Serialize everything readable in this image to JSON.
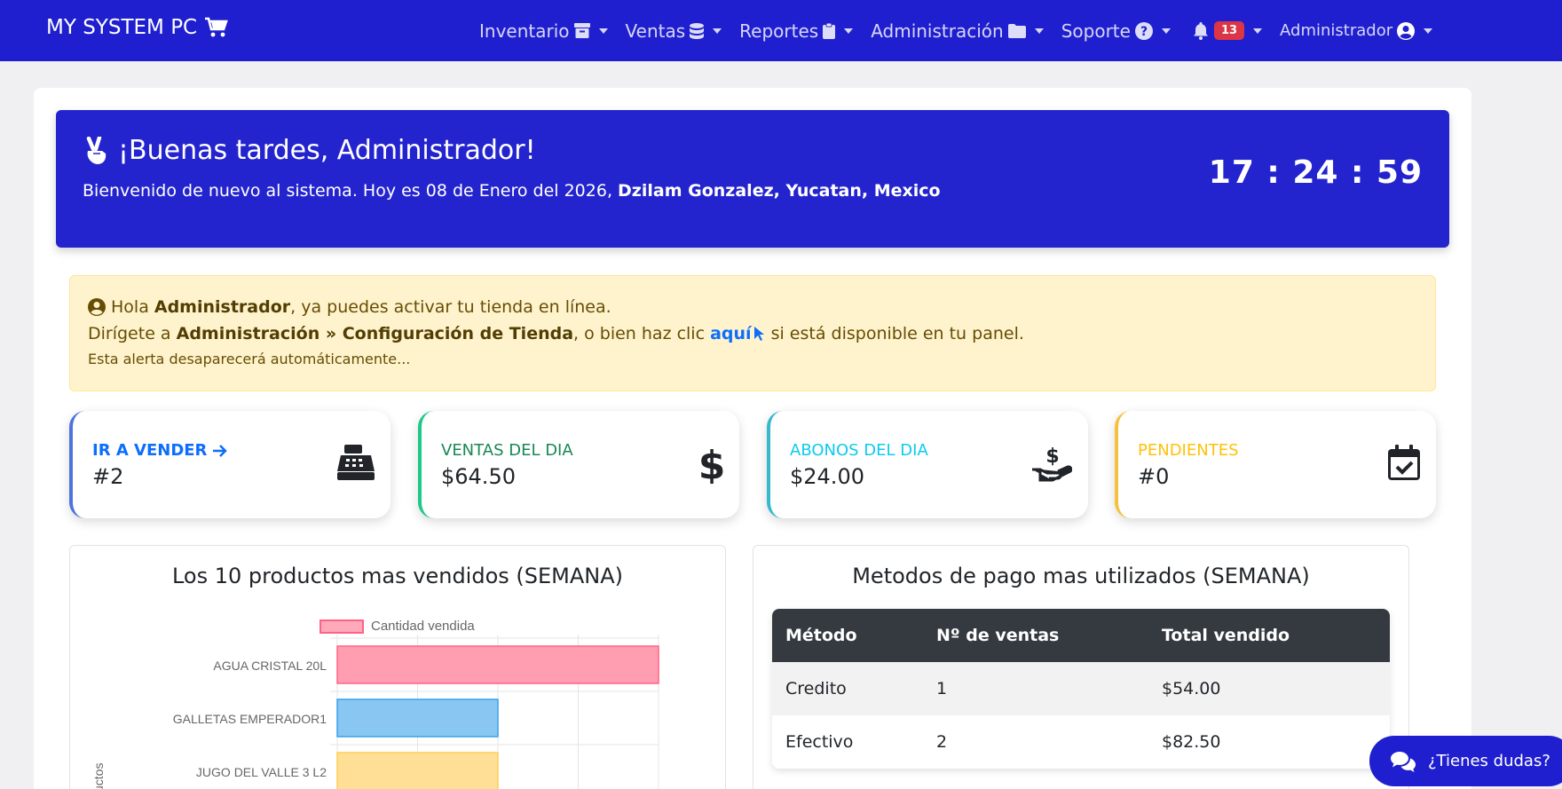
{
  "navbar": {
    "brand": "MY SYSTEM PC",
    "items": [
      {
        "label": "Inventario",
        "icon": "archive-icon"
      },
      {
        "label": "Ventas",
        "icon": "database-icon"
      },
      {
        "label": "Reportes",
        "icon": "clipboard-icon"
      },
      {
        "label": "Administración",
        "icon": "folder-icon"
      },
      {
        "label": "Soporte",
        "icon": "question-circle-icon"
      }
    ],
    "notifications_count": "13",
    "user": "Administrador"
  },
  "welcome": {
    "greeting": "¡Buenas tardes, Administrador!",
    "sub_prefix": "Bienvenido de nuevo al sistema. Hoy es 08 de Enero del 2026, ",
    "location": "Dzilam Gonzalez, Yucatan, Mexico",
    "clock": "17 : 24 : 59"
  },
  "alert": {
    "l1_a": "Hola ",
    "l1_b": "Administrador",
    "l1_c": ", ya puedes activar tu tienda en línea.",
    "l2_a": "Dirígete a ",
    "l2_b": "Administración » Configuración de Tienda",
    "l2_c": ", o bien haz clic ",
    "l2_link": "aquí",
    "l2_d": " si está disponible en tu panel.",
    "l3": "Esta alerta desaparecerá automáticamente..."
  },
  "cards": [
    {
      "label": "IR A VENDER",
      "value": "#2",
      "color": "#4e73df",
      "label_color": "#0d6efd",
      "icon": "cash-register-icon"
    },
    {
      "label": "VENTAS DEL DIA",
      "value": "$64.50",
      "color": "#1cc88a",
      "label_color": "#198754",
      "icon": "dollar-icon"
    },
    {
      "label": "ABONOS DEL DIA",
      "value": "$24.00",
      "color": "#36b9cc",
      "label_color": "#0dcaf0",
      "icon": "hand-holding-dollar-icon"
    },
    {
      "label": "PENDIENTES",
      "value": "#0",
      "color": "#f6c23e",
      "label_color": "#ffc107",
      "icon": "calendar-check-icon"
    }
  ],
  "top_products": {
    "title": "Los 10 productos mas vendidos (SEMANA)",
    "legend": "Cantidad vendida",
    "ylabel_partial": "uctos"
  },
  "chart_data": {
    "type": "bar",
    "orientation": "horizontal",
    "categories": [
      "AGUA CRISTAL 20L",
      "GALLETAS EMPERADOR1",
      "JUGO DEL VALLE 3 L2"
    ],
    "values": [
      4,
      2,
      2
    ],
    "xlim": [
      0,
      4
    ],
    "series": [
      {
        "name": "Cantidad vendida",
        "values": [
          4,
          2,
          2
        ]
      }
    ],
    "colors": [
      "#ff9eb0",
      "#8ac6f2",
      "#ffdf95"
    ],
    "border_colors": [
      "#ff6384",
      "#36a2eb",
      "#ffcd56"
    ],
    "grid": true,
    "legend_position": "top"
  },
  "payments": {
    "title": "Metodos de pago mas utilizados (SEMANA)",
    "headers": [
      "Método",
      "Nº de ventas",
      "Total vendido"
    ],
    "rows": [
      [
        "Credito",
        "1",
        "$54.00"
      ],
      [
        "Efectivo",
        "2",
        "$82.50"
      ]
    ]
  },
  "chat": {
    "label": "¿Tienes dudas?"
  }
}
